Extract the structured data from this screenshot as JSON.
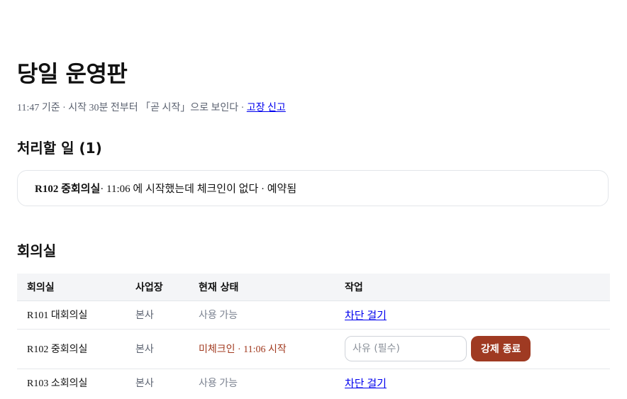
{
  "page": {
    "title": "당일 운영판",
    "meta_text": "11:47 기준 · 시작 30분 전부터 「곧 시작」으로 보인다 · ",
    "report_link": "고장 신고"
  },
  "todo": {
    "title": "처리할 일 (1)",
    "items": [
      {
        "room": "R102 중회의실",
        "detail": " · 11:06 에 시작했는데 체크인이 없다 · 예약됨"
      }
    ]
  },
  "rooms": {
    "title": "회의실",
    "headers": [
      "회의실",
      "사업장",
      "현재 상태",
      "작업"
    ],
    "rows": [
      {
        "name": "R101 대회의실",
        "site": "본사",
        "status": "사용 가능",
        "action": "차단 걸기"
      },
      {
        "name": "R102 중회의실",
        "site": "본사",
        "status": "미체크인 · 11:06 시작",
        "reason_placeholder": "사유 (필수)",
        "button": "강제 종료"
      },
      {
        "name": "R103 소회의실",
        "site": "본사",
        "status": "사용 가능",
        "action": "차단 걸기"
      }
    ]
  },
  "colors": {
    "accent_danger": "#9f3a22",
    "status_warn": "#a13a1f",
    "link": "#0000ee"
  }
}
